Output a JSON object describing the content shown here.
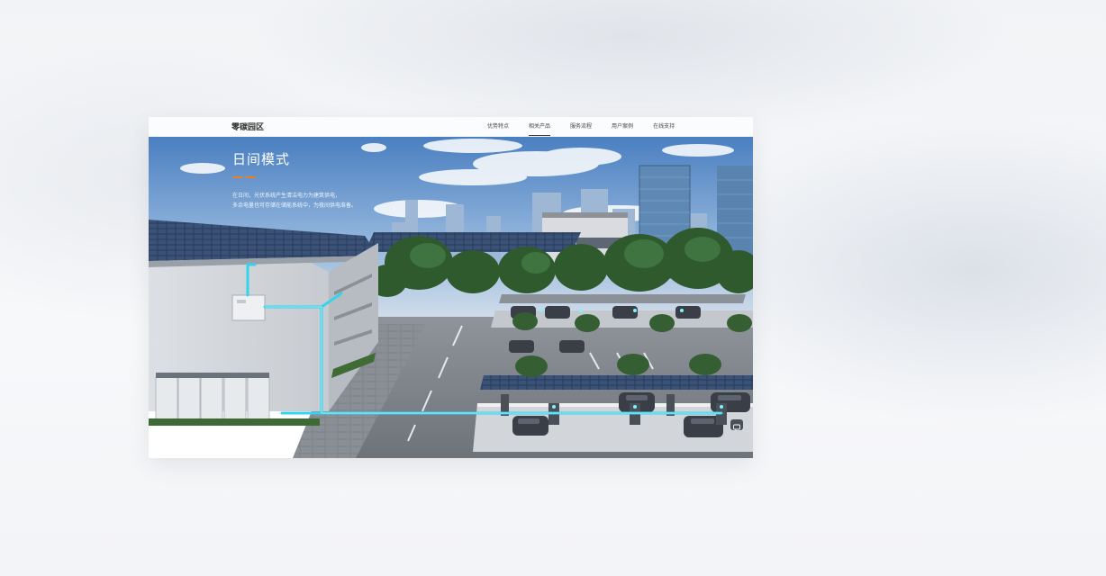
{
  "header": {
    "brand": "零碳园区",
    "nav": [
      {
        "label": "优势特点"
      },
      {
        "label": "相关产品"
      },
      {
        "label": "服务流程"
      },
      {
        "label": "用户案例"
      },
      {
        "label": "在线支持"
      }
    ]
  },
  "hero": {
    "title": "日间模式",
    "desc_line1": "在日间，光伏系统产生清洁电力为建筑供电，",
    "desc_line2": "多余电量也可存储在储能系统中，为夜间供电准备。"
  },
  "colors": {
    "accent": "#e97d2b",
    "energy_flow": "#35d3ec"
  },
  "icons": {
    "chat": "chat-icon"
  }
}
